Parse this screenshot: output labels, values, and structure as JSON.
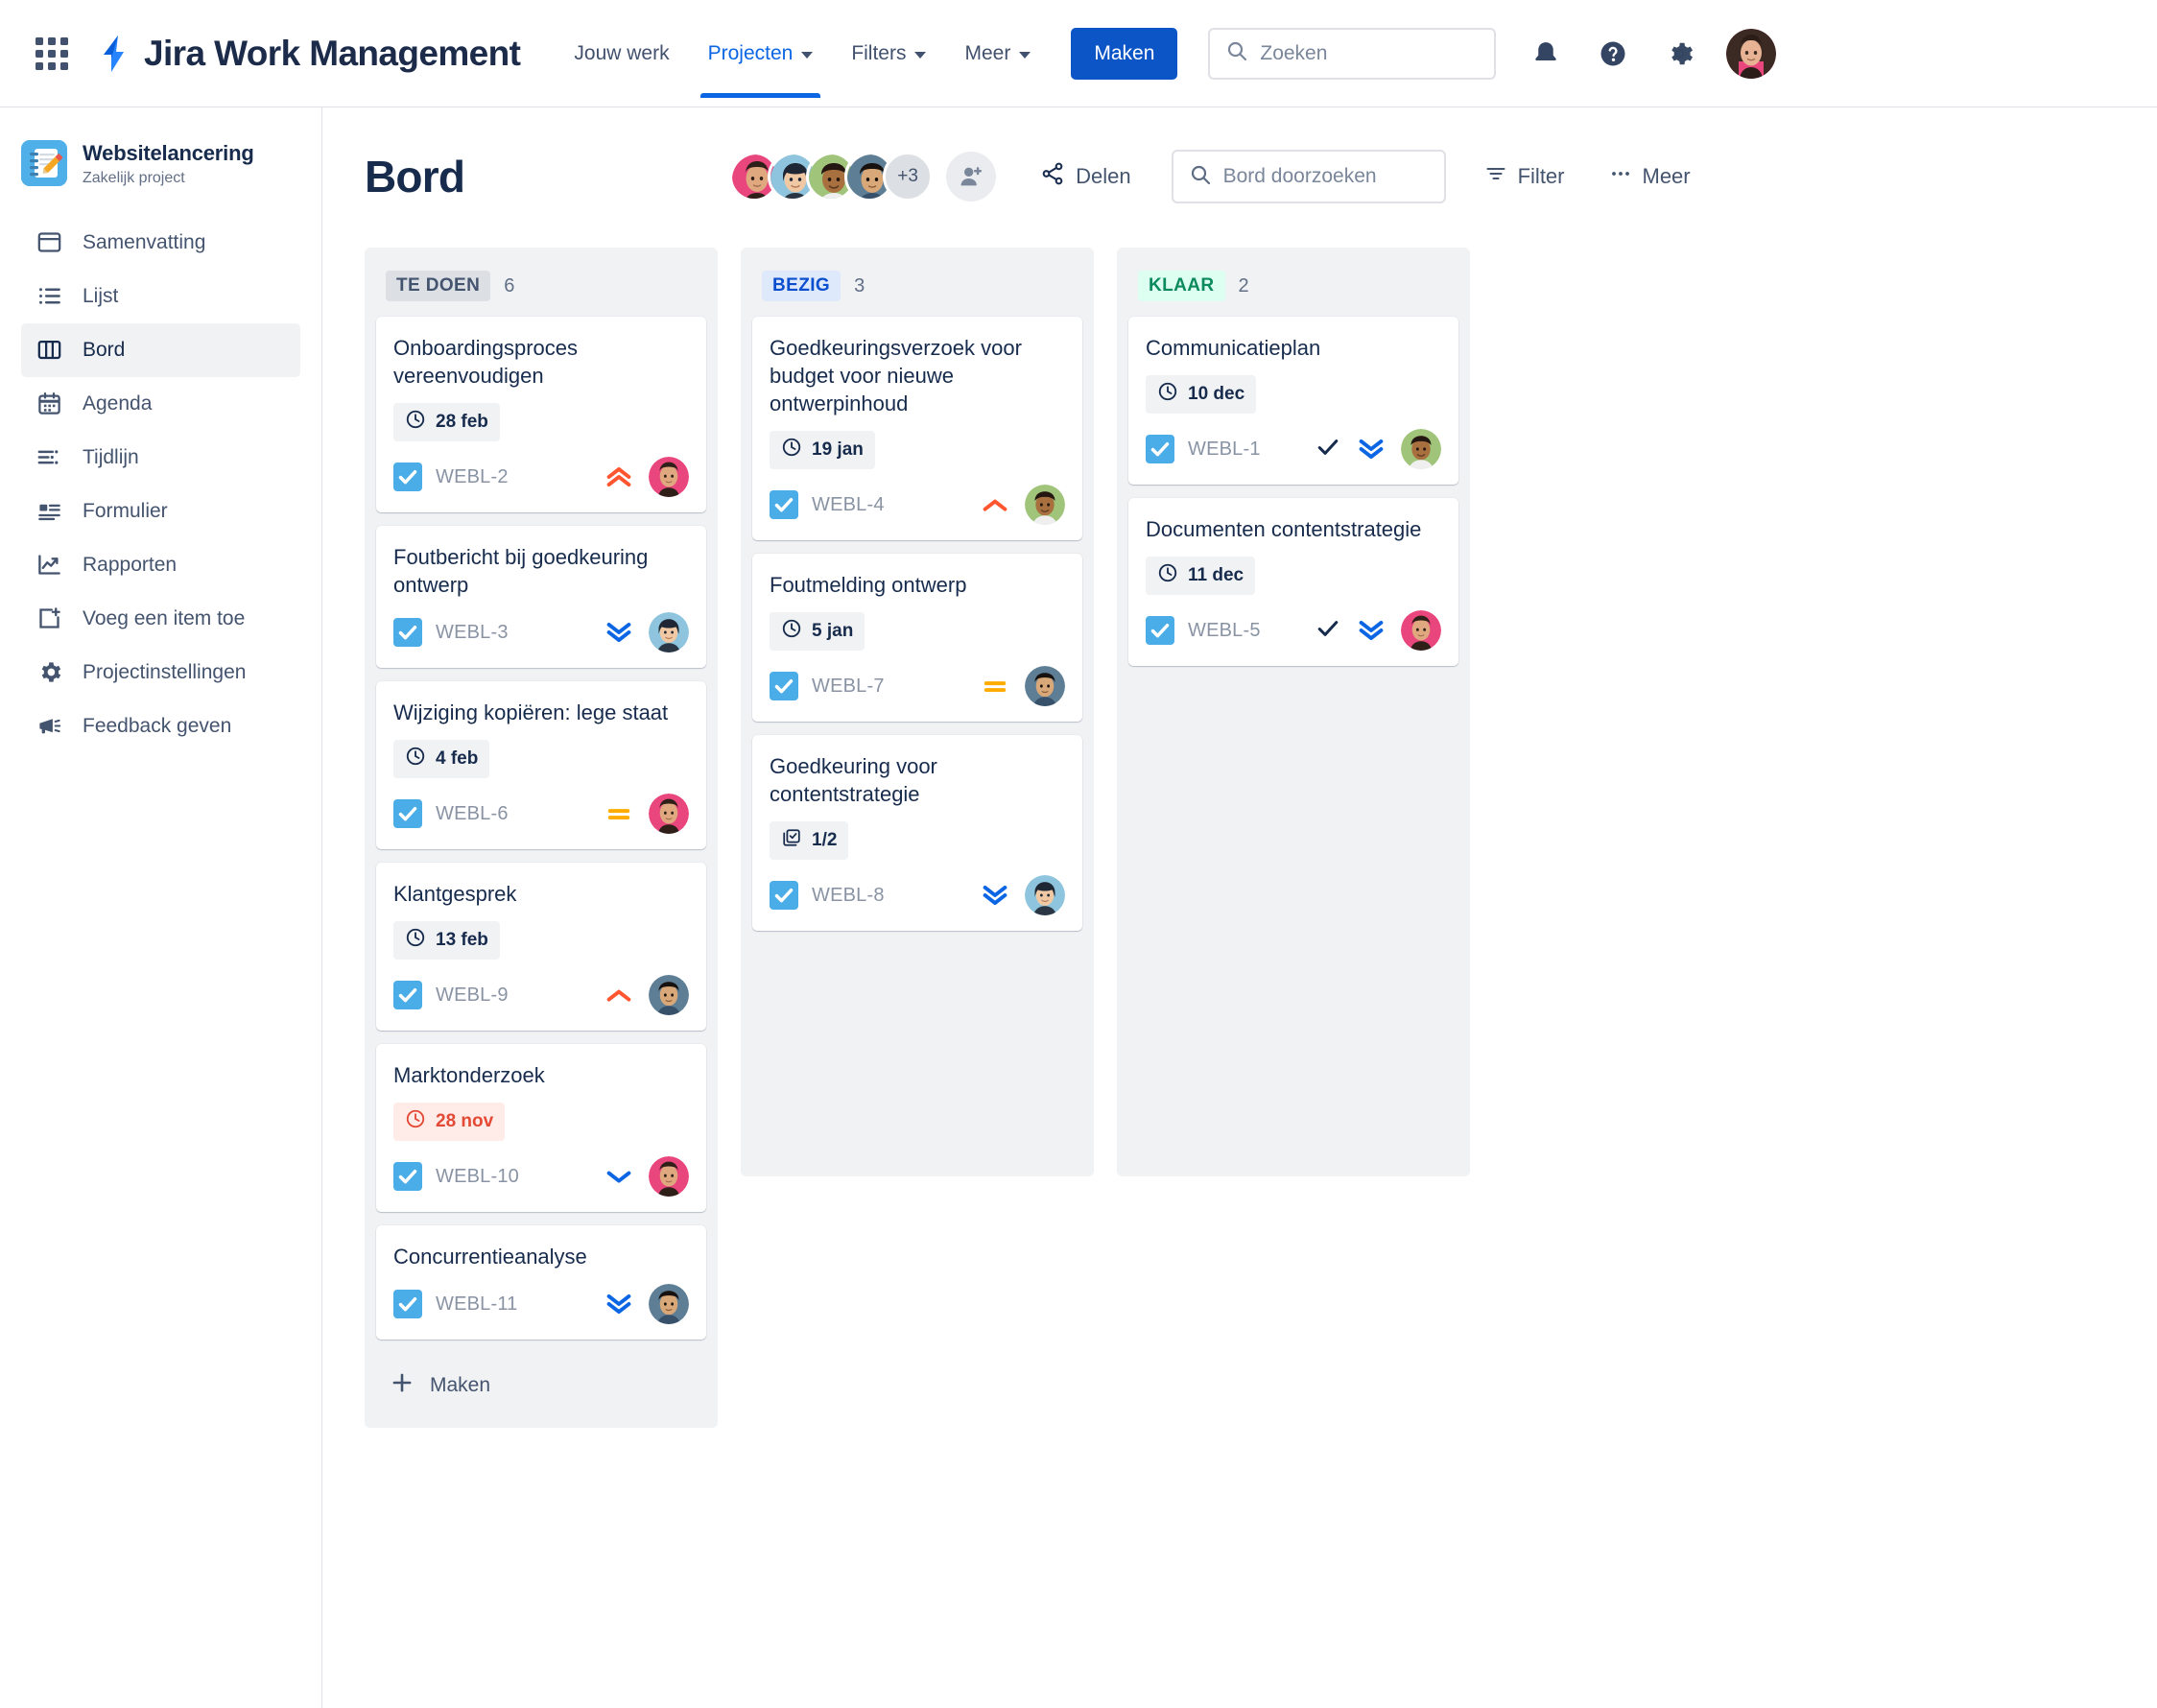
{
  "topnav": {
    "app_switcher": "apps-grid-icon",
    "brand": "Jira Work Management",
    "links": [
      {
        "label": "Jouw werk",
        "has_caret": false,
        "active": false
      },
      {
        "label": "Projecten",
        "has_caret": true,
        "active": true
      },
      {
        "label": "Filters",
        "has_caret": true,
        "active": false
      },
      {
        "label": "Meer",
        "has_caret": true,
        "active": false
      }
    ],
    "create_label": "Maken",
    "search_placeholder": "Zoeken",
    "icons": [
      "notifications-icon",
      "help-icon",
      "settings-icon",
      "user-avatar"
    ]
  },
  "sidebar": {
    "project_name": "Websitelancering",
    "project_type": "Zakelijk project",
    "items": [
      {
        "label": "Samenvatting",
        "icon": "summary-icon",
        "selected": false
      },
      {
        "label": "Lijst",
        "icon": "list-icon",
        "selected": false
      },
      {
        "label": "Bord",
        "icon": "board-icon",
        "selected": true
      },
      {
        "label": "Agenda",
        "icon": "calendar-icon",
        "selected": false
      },
      {
        "label": "Tijdlijn",
        "icon": "timeline-icon",
        "selected": false
      },
      {
        "label": "Formulier",
        "icon": "form-icon",
        "selected": false
      },
      {
        "label": "Rapporten",
        "icon": "reports-icon",
        "selected": false
      },
      {
        "label": "Voeg een item toe",
        "icon": "add-item-icon",
        "selected": false
      },
      {
        "label": "Projectinstellingen",
        "icon": "gear-icon",
        "selected": false
      },
      {
        "label": "Feedback geven",
        "icon": "megaphone-icon",
        "selected": false
      }
    ]
  },
  "board": {
    "title": "Bord",
    "avatar_overflow": "+3",
    "add_people_label": "add-people-icon",
    "share_label": "Delen",
    "search_placeholder": "Bord doorzoeken",
    "filter_label": "Filter",
    "more_label": "Meer",
    "create_label": "Maken"
  },
  "columns": [
    {
      "name": "TE DOEN",
      "count": "6",
      "chip_bg": "#DCDFE4",
      "chip_fg": "#44546F",
      "show_create": true,
      "cards": [
        {
          "title": "Onboardingsproces vereenvoudigen",
          "date": "28 feb",
          "overdue": false,
          "key": "WEBL-2",
          "priority": "highest",
          "done": false,
          "avatar": "av-pink"
        },
        {
          "title": "Foutbericht bij goedkeuring ontwerp",
          "date": "",
          "overdue": false,
          "key": "WEBL-3",
          "priority": "lowest",
          "done": false,
          "avatar": "av-teal"
        },
        {
          "title": "Wijziging kopiëren: lege staat",
          "date": "4 feb",
          "overdue": false,
          "key": "WEBL-6",
          "priority": "medium",
          "done": false,
          "avatar": "av-pink"
        },
        {
          "title": "Klantgesprek",
          "date": "13 feb",
          "overdue": false,
          "key": "WEBL-9",
          "priority": "high",
          "done": false,
          "avatar": "av-slate"
        },
        {
          "title": "Marktonderzoek",
          "date": "28 nov",
          "overdue": true,
          "key": "WEBL-10",
          "priority": "low",
          "done": false,
          "avatar": "av-pink"
        },
        {
          "title": "Concurrentieanalyse",
          "date": "",
          "overdue": false,
          "key": "WEBL-11",
          "priority": "lowest",
          "done": false,
          "avatar": "av-slate"
        }
      ]
    },
    {
      "name": "BEZIG",
      "count": "3",
      "chip_bg": "#DEE9FC",
      "chip_fg": "#0B4FCE",
      "show_create": false,
      "cards": [
        {
          "title": "Goedkeuringsverzoek voor budget voor nieuwe ontwerpinhoud",
          "date": "19 jan",
          "overdue": false,
          "key": "WEBL-4",
          "priority": "high",
          "done": false,
          "avatar": "av-green"
        },
        {
          "title": "Foutmelding ontwerp",
          "date": "5 jan",
          "overdue": false,
          "key": "WEBL-7",
          "priority": "medium",
          "done": false,
          "avatar": "av-slate"
        },
        {
          "title": "Goedkeuring voor contentstrategie",
          "checklist": "1/2",
          "overdue": false,
          "key": "WEBL-8",
          "priority": "lowest",
          "done": false,
          "avatar": "av-teal"
        }
      ]
    },
    {
      "name": "KLAAR",
      "count": "2",
      "chip_bg": "#DCFFF1",
      "chip_fg": "#0B8A5C",
      "show_create": false,
      "cards": [
        {
          "title": "Communicatieplan",
          "date": "10 dec",
          "overdue": false,
          "key": "WEBL-1",
          "priority": "lowest",
          "done": true,
          "avatar": "av-green"
        },
        {
          "title": "Documenten contentstrategie",
          "date": "11 dec",
          "overdue": false,
          "key": "WEBL-5",
          "priority": "lowest",
          "done": true,
          "avatar": "av-pink"
        }
      ]
    }
  ],
  "colors": {
    "brand_blue": "#0C55C6",
    "accent_blue": "#0C66E4",
    "priority_highest": "#FF5630",
    "priority_high": "#FF5630",
    "priority_medium": "#FFAB00",
    "priority_low": "#0C66E4",
    "priority_lowest": "#0C66E4",
    "overdue_red": "#E34935"
  }
}
